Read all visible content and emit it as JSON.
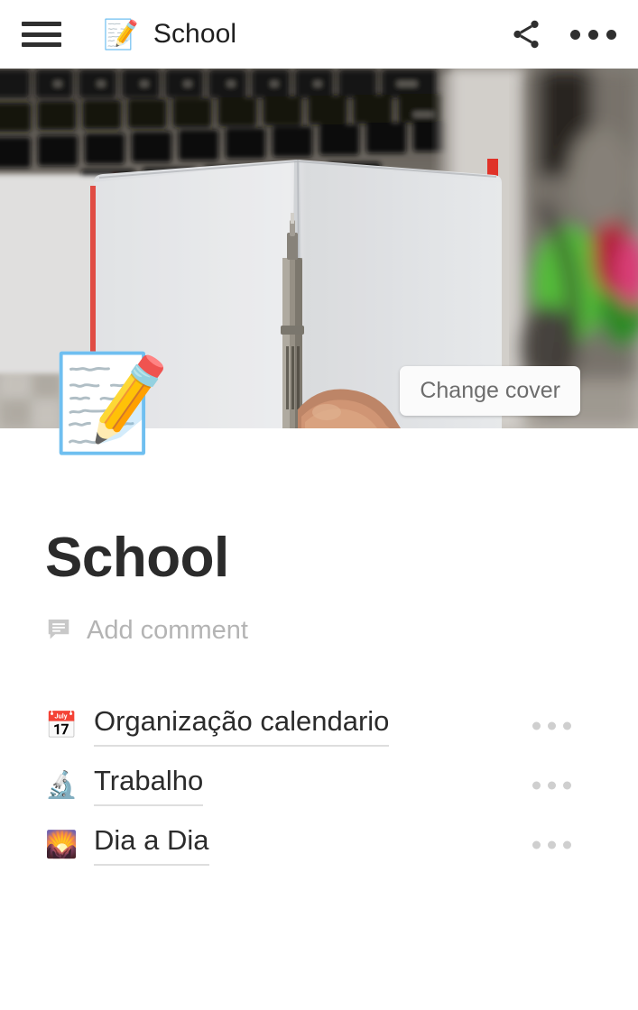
{
  "appbar": {
    "menu_icon": "hamburger-menu-icon",
    "doc_emoji": "📝",
    "title": "School",
    "share_icon": "share-icon",
    "overflow_icon": "more-options-icon"
  },
  "cover": {
    "change_cover_label": "Change cover",
    "description": "Photo of an open blank notebook with red spine on a laptop keyboard, a hand holding a pen"
  },
  "page": {
    "icon_emoji": "📝",
    "title": "School",
    "comment_icon": "comment-bubble-icon",
    "add_comment_label": "Add comment"
  },
  "sub_pages": [
    {
      "emoji": "📅",
      "emoji_name": "calendar-icon",
      "label": "Organização calendario",
      "menu_icon": "more-options-icon"
    },
    {
      "emoji": "🔬",
      "emoji_name": "microscope-icon",
      "label": "Trabalho",
      "menu_icon": "more-options-icon"
    },
    {
      "emoji": "🌄",
      "emoji_name": "sunrise-over-mountains-icon",
      "label": "Dia a Dia",
      "menu_icon": "more-options-icon"
    }
  ],
  "colors": {
    "text_primary": "#2b2b2b",
    "text_muted": "#b4b4b4",
    "underline": "#dedede",
    "dots": "#cfcfcf",
    "background": "#ffffff"
  }
}
